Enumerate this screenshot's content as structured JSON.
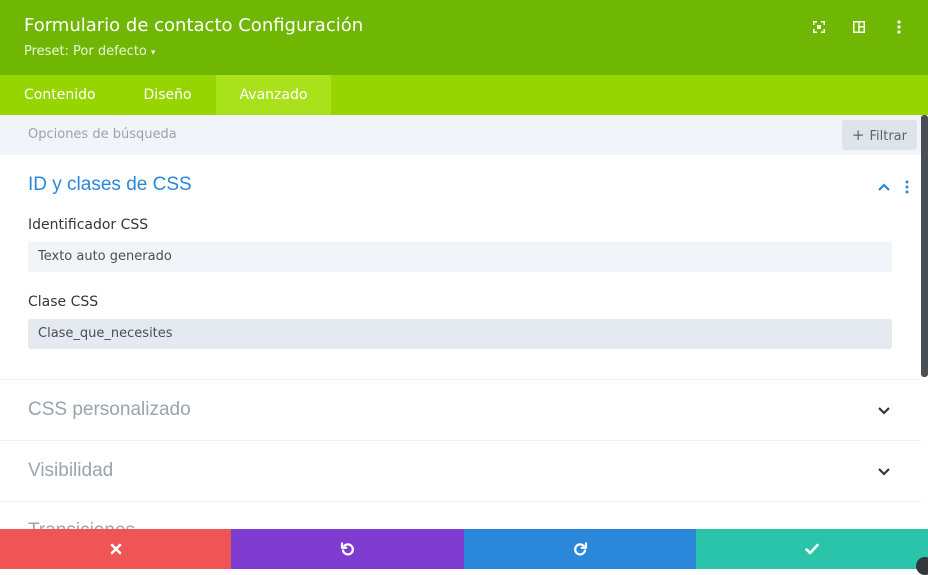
{
  "header": {
    "title": "Formulario de contacto Configuración",
    "preset_label": "Preset: Por defecto",
    "bg_color": "#70b703"
  },
  "tabs": [
    {
      "label": "Contenido",
      "active": false
    },
    {
      "label": "Diseño",
      "active": false
    },
    {
      "label": "Avanzado",
      "active": true
    }
  ],
  "search": {
    "placeholder": "Opciones de búsqueda",
    "filter_label": "Filtrar"
  },
  "sections": {
    "css_id_classes": {
      "title": "ID y clases de CSS",
      "expanded": true,
      "id_label": "Identificador CSS",
      "id_value": "Texto auto generado",
      "class_label": "Clase CSS",
      "class_value": "Clase_que_necesites"
    },
    "custom_css": {
      "title": "CSS personalizado",
      "expanded": false
    },
    "visibility": {
      "title": "Visibilidad",
      "expanded": false
    },
    "transitions": {
      "title": "Transiciones",
      "expanded": false
    }
  },
  "footer": {
    "discard_color": "#ef5555",
    "undo_color": "#7e3bd0",
    "redo_color": "#2b87da",
    "save_color": "#29c4a9"
  }
}
